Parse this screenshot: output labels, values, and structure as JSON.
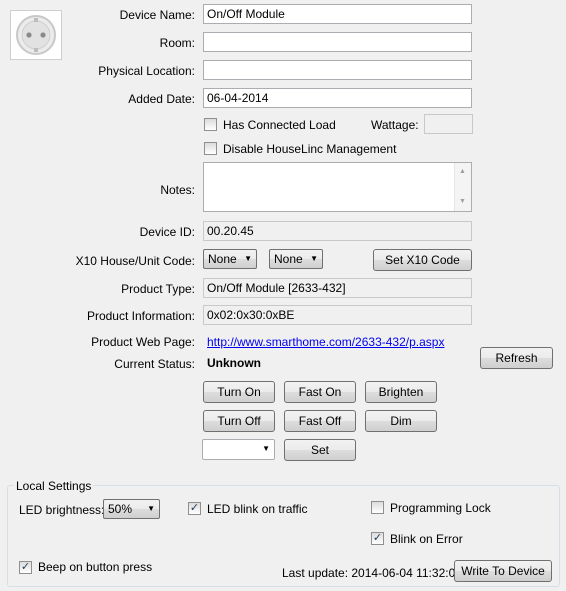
{
  "device": {
    "name_label": "Device Name:",
    "name_value": "On/Off Module",
    "room_label": "Room:",
    "room_value": "",
    "location_label": "Physical Location:",
    "location_value": "",
    "added_label": "Added Date:",
    "added_value": "06-04-2014",
    "connected_load_label": "Has Connected Load",
    "connected_load_checked": false,
    "wattage_label": "Wattage:",
    "wattage_value": "",
    "disable_mgmt_label": "Disable HouseLinc Management",
    "disable_mgmt_checked": false,
    "notes_label": "Notes:",
    "notes_value": "",
    "device_id_label": "Device ID:",
    "device_id_value": "00.20.45",
    "x10_label": "X10 House/Unit Code:",
    "x10_house": "None",
    "x10_unit": "None",
    "set_x10_button": "Set X10 Code",
    "product_type_label": "Product Type:",
    "product_type_value": "On/Off Module [2633-432]",
    "product_info_label": "Product Information:",
    "product_info_value": "0x02:0x30:0xBE",
    "web_page_label": "Product Web Page:",
    "web_page_link": "http://www.smarthome.com/2633-432/p.aspx",
    "status_label": "Current Status:",
    "status_value": "Unknown",
    "refresh_button": "Refresh"
  },
  "controls": {
    "turn_on": "Turn On",
    "fast_on": "Fast On",
    "brighten": "Brighten",
    "turn_off": "Turn Off",
    "fast_off": "Fast Off",
    "dim": "Dim",
    "level_value": "",
    "set": "Set"
  },
  "local_settings": {
    "title": "Local Settings",
    "led_brightness_label": "LED brightness:",
    "led_brightness_value": "50%",
    "led_blink_label": "LED blink on traffic",
    "led_blink_checked": true,
    "programming_lock_label": "Programming Lock",
    "programming_lock_checked": false,
    "blink_error_label": "Blink on Error",
    "blink_error_checked": true,
    "beep_label": "Beep on button press",
    "beep_checked": true,
    "last_update": "Last update: 2014-06-04 11:32:00",
    "write_button": "Write To Device"
  },
  "icons": {
    "device_icon": "outlet-icon",
    "combo_arrow": "chevron-down-icon",
    "scroll_up": "scroll-up-arrow-icon",
    "scroll_down": "scroll-down-arrow-icon"
  },
  "colors": {
    "window_bg": "#f0f0f0",
    "link": "#0000ee"
  }
}
